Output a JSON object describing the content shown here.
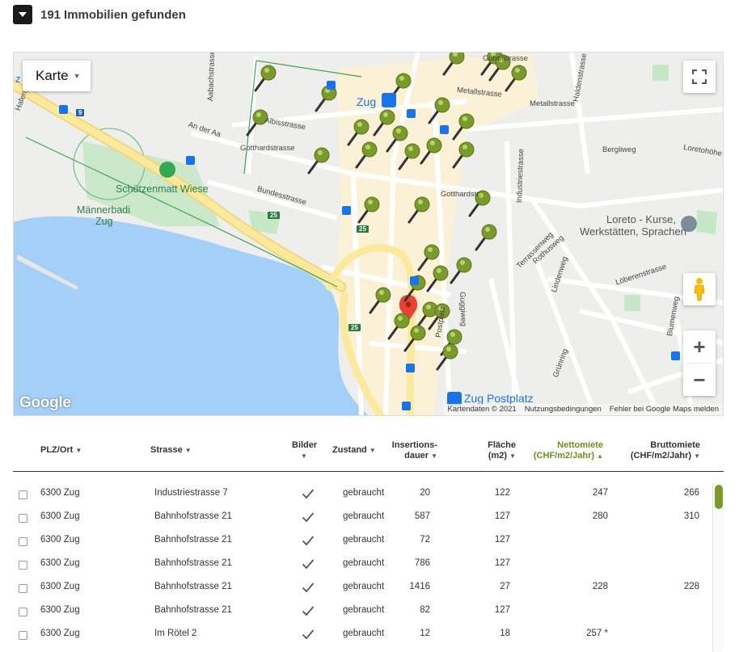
{
  "header": {
    "result_count": "191",
    "result_label": "Immobilien gefunden"
  },
  "map": {
    "type_selector": "Karte",
    "attribution": [
      "Kartendaten © 2021",
      "Nutzungsbedingungen",
      "Fehler bei Google Maps melden"
    ],
    "google_logo": "Google",
    "streets": [
      "Aabachstrasse",
      "Albisstrasse",
      "An der Aa",
      "Gotthardstrasse",
      "Bundesstrasse",
      "Metallstrasse",
      "Industriestrasse",
      "Haldenstrasse",
      "Bergliweg",
      "Loretohöhe",
      "Terrassenweg",
      "Rothusweg",
      "Lindenweg",
      "Löberenstrasse",
      "Blumenweg",
      "Grünring",
      "Guggiweg",
      "Postplatz",
      "Hafenpl.",
      "Gotthardstr.",
      "Gubelstrasse"
    ],
    "places": {
      "schuetzenmatt": "Schützenmatt Wiese",
      "maennerbadi": "Männerbadi",
      "maennerbadi_2": "Zug",
      "zug": "Zug",
      "zug_postplatz": "Zug Postplatz",
      "loreto": "Loreto - Kurse,",
      "loreto_2": "Werkstätten, Sprachen"
    },
    "routes": [
      "9",
      "25",
      "25",
      "25"
    ],
    "colors": {
      "pin": "#7a9a2c",
      "marker": "#ea4335",
      "water": "#a4cff7",
      "park": "#c6e8c6",
      "road_major": "#f6e48b"
    }
  },
  "table": {
    "headers": {
      "plz_ort": "PLZ/Ort",
      "strasse": "Strasse",
      "bilder": "Bilder",
      "zustand": "Zustand",
      "insertions_1": "Insertions-",
      "insertions_2": "dauer",
      "flaeche_1": "Fläche",
      "flaeche_2": "(m2)",
      "netto_1": "Nettomiete",
      "netto_2": "(CHF/m2/Jahr)",
      "brutto_1": "Bruttomiete",
      "brutto_2": "(CHF/m2/Jahr)"
    },
    "rows": [
      {
        "plz_ort": "6300 Zug",
        "strasse": "Industriestrasse 7",
        "zustand": "gebraucht",
        "dauer": "20",
        "flaeche": "122",
        "netto": "247",
        "brutto": "266"
      },
      {
        "plz_ort": "6300 Zug",
        "strasse": "Bahnhofstrasse 21",
        "zustand": "gebraucht",
        "dauer": "587",
        "flaeche": "127",
        "netto": "280",
        "brutto": "310"
      },
      {
        "plz_ort": "6300 Zug",
        "strasse": "Bahnhofstrasse 21",
        "zustand": "gebraucht",
        "dauer": "72",
        "flaeche": "127",
        "netto": "",
        "brutto": ""
      },
      {
        "plz_ort": "6300 Zug",
        "strasse": "Bahnhofstrasse 21",
        "zustand": "gebraucht",
        "dauer": "786",
        "flaeche": "127",
        "netto": "",
        "brutto": ""
      },
      {
        "plz_ort": "6300 Zug",
        "strasse": "Bahnhofstrasse 21",
        "zustand": "gebraucht",
        "dauer": "1416",
        "flaeche": "27",
        "netto": "228",
        "brutto": "228"
      },
      {
        "plz_ort": "6300 Zug",
        "strasse": "Bahnhofstrasse 21",
        "zustand": "gebraucht",
        "dauer": "82",
        "flaeche": "127",
        "netto": "",
        "brutto": ""
      },
      {
        "plz_ort": "6300 Zug",
        "strasse": "Im Rötel 2",
        "zustand": "gebraucht",
        "dauer": "12",
        "flaeche": "18",
        "netto": "257 *",
        "brutto": ""
      }
    ]
  }
}
